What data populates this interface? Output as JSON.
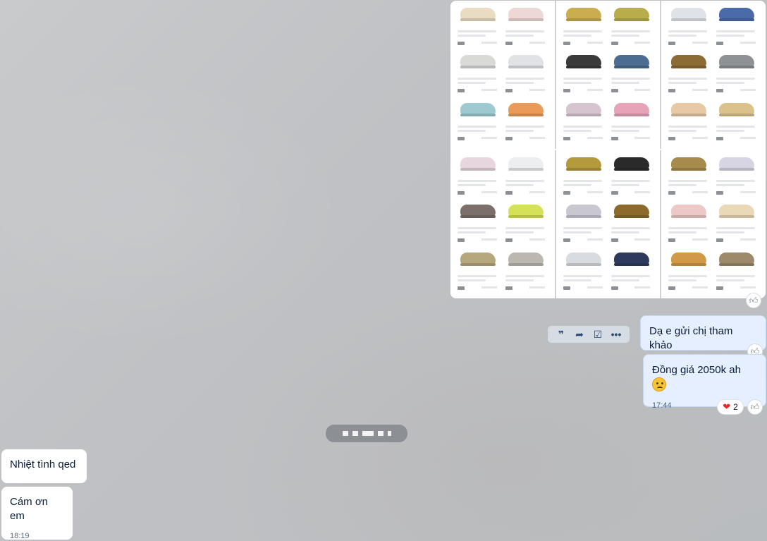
{
  "messages": {
    "sent_1": {
      "text": "Dạ e gửi chị tham khảo"
    },
    "sent_2": {
      "text": "Đồng giá 2050k ah",
      "time": "17:44",
      "reaction_count": "2"
    },
    "recv_1": {
      "text": "Nhiệt tình qed"
    },
    "recv_2": {
      "text": "Cám ơn em",
      "time": "18:19"
    }
  },
  "toolbar": {
    "quote_icon": "quote-icon",
    "forward_icon": "forward-icon",
    "task_icon": "task-icon",
    "more_icon": "more-icon"
  },
  "shoe_colors": [
    [
      "#e9dcc2",
      "#eed8d6",
      "#d9d9d6",
      "#e0e2e5",
      "#9ccad0",
      "#ea9b5a"
    ],
    [
      "#c9ad4e",
      "#b8ad4a",
      "#3a3a3a",
      "#4c6d91",
      "#d6c4cf",
      "#e7a4b9"
    ],
    [
      "#dfe3e8",
      "#4a6aa9",
      "#8c6b34",
      "#8e9294",
      "#e7c9a6",
      "#dbc28c"
    ],
    [
      "#e8d6df",
      "#eceef0",
      "#7c6f6a",
      "#d6e256",
      "#b6a77c",
      "#bcb8b0"
    ],
    [
      "#b39a3d",
      "#2a2a2a",
      "#c9c7d2",
      "#8b6a2c",
      "#d8dbdf",
      "#2d3a5e"
    ],
    [
      "#a68b4d",
      "#d7d5e4",
      "#ecc9c6",
      "#ead9b6",
      "#d19a49",
      "#9d8a6a"
    ]
  ],
  "colors": {
    "bubble_me": "#e5efff",
    "bubble_them": "#ffffff",
    "accent": "#2e4c73"
  }
}
